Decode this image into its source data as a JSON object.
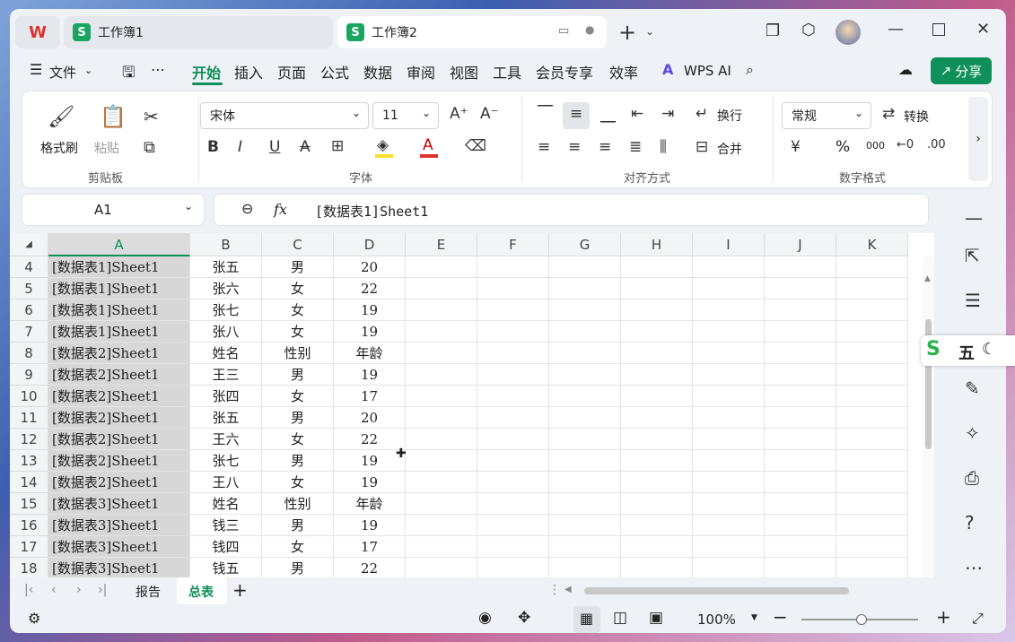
{
  "tabs": {
    "home_logo": "W",
    "tab1": "工作簿1",
    "tab2": "工作簿2",
    "tab_icon": "S"
  },
  "menu": {
    "file": "文件",
    "items": [
      "开始",
      "插入",
      "页面",
      "公式",
      "数据",
      "审阅",
      "视图",
      "工具",
      "会员专享",
      "效率"
    ],
    "wps_ai": "WPS AI",
    "share": "分享"
  },
  "ribbon": {
    "clipboard": {
      "format_painter": "格式刷",
      "paste": "粘贴",
      "label": "剪贴板"
    },
    "font": {
      "name": "宋体",
      "size": "11",
      "label": "字体"
    },
    "align": {
      "wrap": "换行",
      "merge": "合并",
      "label": "对齐方式"
    },
    "number": {
      "format": "常规",
      "convert": "转换",
      "label": "数字格式",
      "percent": "%",
      "thousands": "000"
    }
  },
  "formula_bar": {
    "cell_ref": "A1",
    "fx": "fx",
    "value": "[数据表1]Sheet1"
  },
  "columns": [
    "A",
    "B",
    "C",
    "D",
    "E",
    "F",
    "G",
    "H",
    "I",
    "J",
    "K"
  ],
  "rows": [
    {
      "n": "4",
      "a": "[数据表1]Sheet1",
      "b": "张五",
      "c": "男",
      "d": "20"
    },
    {
      "n": "5",
      "a": "[数据表1]Sheet1",
      "b": "张六",
      "c": "女",
      "d": "22"
    },
    {
      "n": "6",
      "a": "[数据表1]Sheet1",
      "b": "张七",
      "c": "女",
      "d": "19"
    },
    {
      "n": "7",
      "a": "[数据表1]Sheet1",
      "b": "张八",
      "c": "女",
      "d": "19"
    },
    {
      "n": "8",
      "a": "[数据表2]Sheet1",
      "b": "姓名",
      "c": "性别",
      "d": "年龄"
    },
    {
      "n": "9",
      "a": "[数据表2]Sheet1",
      "b": "王三",
      "c": "男",
      "d": "19"
    },
    {
      "n": "10",
      "a": "[数据表2]Sheet1",
      "b": "张四",
      "c": "女",
      "d": "17"
    },
    {
      "n": "11",
      "a": "[数据表2]Sheet1",
      "b": "张五",
      "c": "男",
      "d": "20"
    },
    {
      "n": "12",
      "a": "[数据表2]Sheet1",
      "b": "王六",
      "c": "女",
      "d": "22"
    },
    {
      "n": "13",
      "a": "[数据表2]Sheet1",
      "b": "张七",
      "c": "男",
      "d": "19"
    },
    {
      "n": "14",
      "a": "[数据表2]Sheet1",
      "b": "王八",
      "c": "女",
      "d": "19"
    },
    {
      "n": "15",
      "a": "[数据表3]Sheet1",
      "b": "姓名",
      "c": "性别",
      "d": "年龄"
    },
    {
      "n": "16",
      "a": "[数据表3]Sheet1",
      "b": "钱三",
      "c": "男",
      "d": "19"
    },
    {
      "n": "17",
      "a": "[数据表3]Sheet1",
      "b": "钱四",
      "c": "女",
      "d": "17"
    },
    {
      "n": "18",
      "a": "[数据表3]Sheet1",
      "b": "钱五",
      "c": "男",
      "d": "22"
    }
  ],
  "sheets": [
    "报告",
    "总表"
  ],
  "status": {
    "zoom": "100%"
  },
  "ime": {
    "label": "五"
  },
  "colors": {
    "accent": "#0f8f5a",
    "wps_red": "#e0312c",
    "sheet_green": "#1aa563"
  }
}
